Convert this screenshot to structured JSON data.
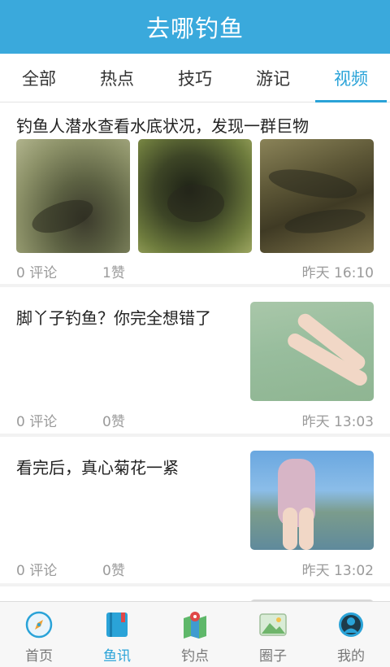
{
  "header": {
    "title": "去哪钓鱼"
  },
  "tabs": [
    {
      "label": "全部"
    },
    {
      "label": "热点"
    },
    {
      "label": "技巧"
    },
    {
      "label": "游记"
    },
    {
      "label": "视频"
    }
  ],
  "feed": [
    {
      "title": "钓鱼人潜水查看水底状况，发现一群巨物",
      "comments": "0 评论",
      "likes": "1赞",
      "time": "昨天 16:10"
    },
    {
      "title": "脚丫子钓鱼？你完全想错了",
      "comments": "0 评论",
      "likes": "0赞",
      "time": "昨天 13:03"
    },
    {
      "title": "看完后，真心菊花一紧",
      "comments": "0 评论",
      "likes": "0赞",
      "time": "昨天 13:02"
    }
  ],
  "bottom_nav": [
    {
      "label": "首页",
      "icon": "compass-icon"
    },
    {
      "label": "鱼讯",
      "icon": "book-icon"
    },
    {
      "label": "钓点",
      "icon": "map-pin-icon"
    },
    {
      "label": "圈子",
      "icon": "photos-icon"
    },
    {
      "label": "我的",
      "icon": "profile-icon"
    }
  ]
}
